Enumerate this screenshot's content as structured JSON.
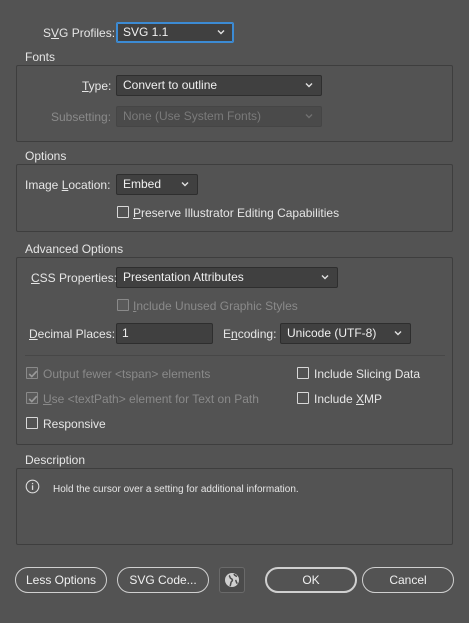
{
  "svg_profiles": {
    "label_pre": "S",
    "label_u": "V",
    "label_post": "G Profiles:",
    "value": "SVG 1.1"
  },
  "fonts": {
    "title": "Fonts",
    "type_label_u": "T",
    "type_label_post": "ype:",
    "type_value": "Convert to outline",
    "subsetting_label": "Subsetting:",
    "subsetting_value": "None (Use System Fonts)"
  },
  "options": {
    "title": "Options",
    "image_location_label_pre": "Image ",
    "image_location_label_u": "L",
    "image_location_label_post": "ocation:",
    "image_location_value": "Embed",
    "preserve_u": "P",
    "preserve_post": "reserve Illustrator Editing Capabilities"
  },
  "advanced": {
    "title": "Advanced Options",
    "css_label_u": "C",
    "css_label_post": "SS Properties:",
    "css_value": "Presentation Attributes",
    "include_unused_u": "I",
    "include_unused_post": "nclude Unused Graphic Styles",
    "decimal_label_u": "D",
    "decimal_label_post": "ecimal Places:",
    "decimal_value": "1",
    "encoding_label_pre": "E",
    "encoding_label_u": "n",
    "encoding_label_post": "coding:",
    "encoding_value": "Unicode (UTF-8)",
    "output_fewer": "Output fewer <tspan> elements",
    "use_textpath_u": "U",
    "use_textpath_post": "se <textPath> element for Text on Path",
    "responsive": "Responsive",
    "include_slicing": "Include Slicing Data",
    "include_xmp_pre": "Include ",
    "include_xmp_u": "X",
    "include_xmp_post": "MP"
  },
  "description": {
    "title": "Description",
    "text": "Hold the cursor over a setting for additional information."
  },
  "buttons": {
    "less_options": "Less Options",
    "svg_code": "SVG Code...",
    "ok": "OK",
    "cancel": "Cancel"
  },
  "colors": {
    "background": "#535353",
    "focus": "#3c8bd4"
  }
}
